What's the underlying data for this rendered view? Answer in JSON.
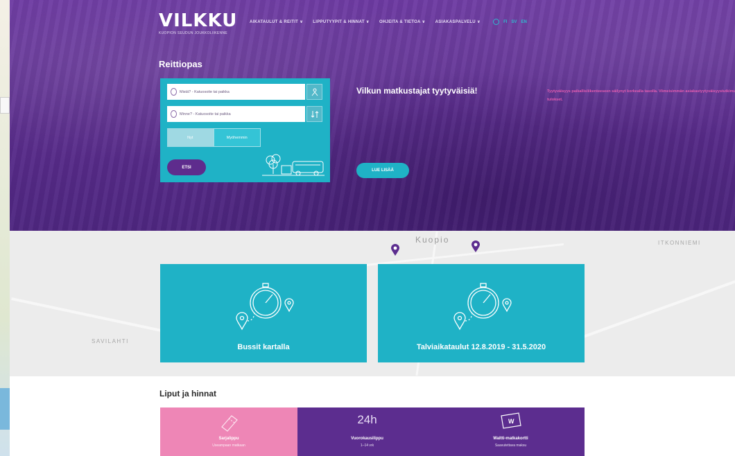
{
  "brand": {
    "name": "VILKKU",
    "tagline": "KUOPION SEUDUN JOUKKOLIIKENNE"
  },
  "nav": {
    "items": [
      "AIKATAULUT & REITIT",
      "LIPPUTYYPIT & HINNAT",
      "OHJEITA & TIETOA",
      "ASIAKASPALVELU"
    ],
    "languages": [
      "FI",
      "SV",
      "EN"
    ]
  },
  "planner": {
    "title": "Reittiopas",
    "from_placeholder": "Mistä? - Katuosoite tai paikka",
    "to_placeholder": "Minne? - Katuosoite tai paikka",
    "time_options": [
      "Nyt",
      "Myöhemmin"
    ],
    "search_label": "ETSI"
  },
  "promo": {
    "title": "Vilkun matkustajat tyytyväisiä!",
    "text": "Tyytyväisyys paikallisliikenteeseen säilynyt korkealla tasolla. Viimeisimmän asiakastyytyväisyystutkimuksen tulokset.",
    "button_label": "LUE LISÄÄ"
  },
  "map": {
    "labels": [
      "Kuopio",
      "ITKONNIEMI",
      "SAVILAHTI"
    ]
  },
  "tiles": [
    {
      "label": "Bussit kartalla"
    },
    {
      "label": "Talviaikataulut 12.8.2019 - 31.5.2020"
    }
  ],
  "tickets": {
    "title": "Liput ja hinnat",
    "items": [
      {
        "name": "Sarjalippu",
        "sub": "Useampaan matkaan",
        "color": "#ee86b6"
      },
      {
        "badge": "24h",
        "name": "Vuorokausilippu",
        "sub": "1–14 vrk",
        "color": "#5c2d8f"
      },
      {
        "name": "Waltti-matkakortti",
        "sub": "Saavutettava maksu",
        "color": "#5c2d8f"
      }
    ]
  },
  "colors": {
    "purple": "#5c2d8f",
    "turquoise": "#1fb2c6",
    "pink": "#ee86b6"
  }
}
